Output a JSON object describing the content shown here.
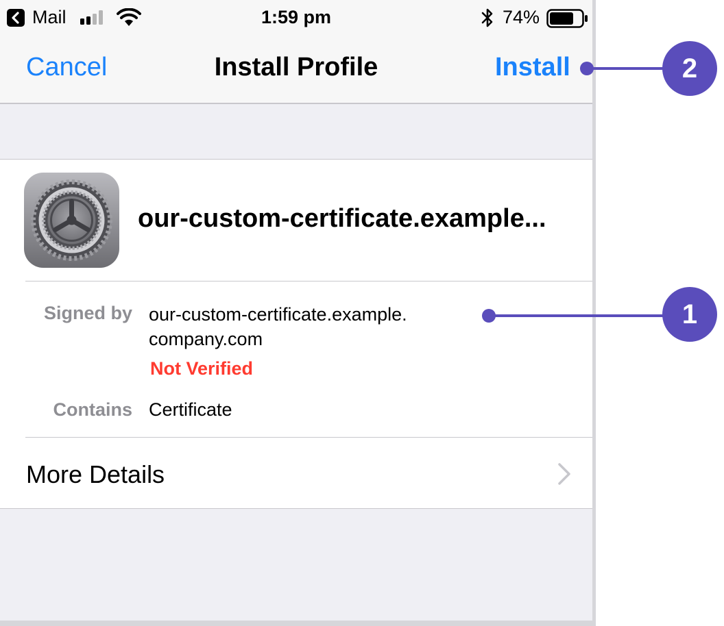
{
  "status_bar": {
    "back_app": "Mail",
    "time": "1:59 pm",
    "battery_percent": "74%",
    "battery_level": 0.74,
    "icons": [
      "back-arrow-icon",
      "signal-bars-icon",
      "wifi-icon",
      "bluetooth-icon",
      "battery-icon"
    ]
  },
  "nav": {
    "cancel_label": "Cancel",
    "title": "Install Profile",
    "install_label": "Install"
  },
  "profile": {
    "icon": "settings-gear-icon",
    "name": "our-custom-certificate.example...",
    "signed_by_label": "Signed by",
    "signed_by_value": "our-custom-certificate.example.\ncompany.com",
    "verification_status": "Not Verified",
    "contains_label": "Contains",
    "contains_value": "Certificate",
    "more_details_label": "More Details"
  },
  "annotations": {
    "callout_1": "1",
    "callout_2": "2"
  },
  "colors": {
    "accent_blue": "#1a82fb",
    "not_verified_red": "#ff3b30",
    "callout_purple": "#5a4dbb",
    "secondary_gray": "#8e8e93"
  }
}
